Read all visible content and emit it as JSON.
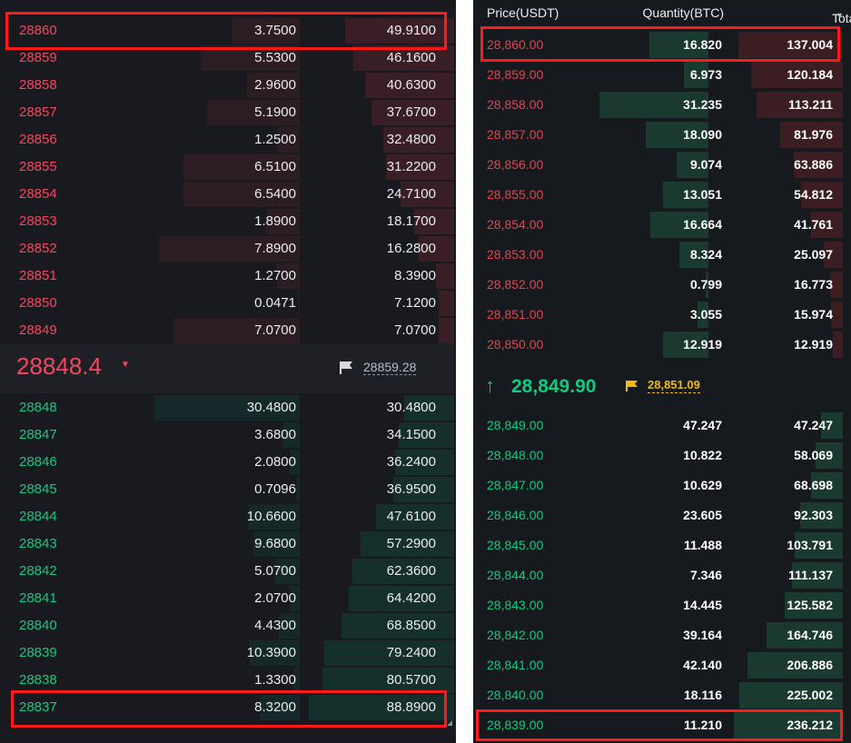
{
  "left_panel": {
    "asks": [
      {
        "price": "28860",
        "quantity": "3.7500",
        "total": "49.9100"
      },
      {
        "price": "28859",
        "quantity": "5.5300",
        "total": "46.1600"
      },
      {
        "price": "28858",
        "quantity": "2.9600",
        "total": "40.6300"
      },
      {
        "price": "28857",
        "quantity": "5.1900",
        "total": "37.6700"
      },
      {
        "price": "28856",
        "quantity": "1.2500",
        "total": "32.4800"
      },
      {
        "price": "28855",
        "quantity": "6.5100",
        "total": "31.2200"
      },
      {
        "price": "28854",
        "quantity": "6.5400",
        "total": "24.7100"
      },
      {
        "price": "28853",
        "quantity": "1.8900",
        "total": "18.1700"
      },
      {
        "price": "28852",
        "quantity": "7.8900",
        "total": "16.2800"
      },
      {
        "price": "28851",
        "quantity": "1.2700",
        "total": "8.3900"
      },
      {
        "price": "28850",
        "quantity": "0.0471",
        "total": "7.1200"
      },
      {
        "price": "28849",
        "quantity": "7.0700",
        "total": "7.0700"
      }
    ],
    "last_price": "28848.4",
    "mark_price": "28859.28",
    "bids": [
      {
        "price": "28848",
        "quantity": "30.4800",
        "total": "30.4800"
      },
      {
        "price": "28847",
        "quantity": "3.6800",
        "total": "34.1500"
      },
      {
        "price": "28846",
        "quantity": "2.0800",
        "total": "36.2400"
      },
      {
        "price": "28845",
        "quantity": "0.7096",
        "total": "36.9500"
      },
      {
        "price": "28844",
        "quantity": "10.6600",
        "total": "47.6100"
      },
      {
        "price": "28843",
        "quantity": "9.6800",
        "total": "57.2900"
      },
      {
        "price": "28842",
        "quantity": "5.0700",
        "total": "62.3600"
      },
      {
        "price": "28841",
        "quantity": "2.0700",
        "total": "64.4200"
      },
      {
        "price": "28840",
        "quantity": "4.4300",
        "total": "68.8500"
      },
      {
        "price": "28839",
        "quantity": "10.3900",
        "total": "79.2400"
      },
      {
        "price": "28838",
        "quantity": "1.3300",
        "total": "80.5700"
      },
      {
        "price": "28837",
        "quantity": "8.3200",
        "total": "88.8900"
      }
    ]
  },
  "right_panel": {
    "header": {
      "price": "Price(USDT)",
      "quantity": "Quantity(BTC)",
      "total": "Total(BTC)"
    },
    "asks": [
      {
        "price": "28,860.00",
        "quantity": "16.820",
        "total": "137.004"
      },
      {
        "price": "28,859.00",
        "quantity": "6.973",
        "total": "120.184"
      },
      {
        "price": "28,858.00",
        "quantity": "31.235",
        "total": "113.211"
      },
      {
        "price": "28,857.00",
        "quantity": "18.090",
        "total": "81.976"
      },
      {
        "price": "28,856.00",
        "quantity": "9.074",
        "total": "63.886"
      },
      {
        "price": "28,855.00",
        "quantity": "13.051",
        "total": "54.812"
      },
      {
        "price": "28,854.00",
        "quantity": "16.664",
        "total": "41.761"
      },
      {
        "price": "28,853.00",
        "quantity": "8.324",
        "total": "25.097"
      },
      {
        "price": "28,852.00",
        "quantity": "0.799",
        "total": "16.773"
      },
      {
        "price": "28,851.00",
        "quantity": "3.055",
        "total": "15.974"
      },
      {
        "price": "28,850.00",
        "quantity": "12.919",
        "total": "12.919"
      }
    ],
    "last_price": "28,849.90",
    "mark_price": "28,851.09",
    "bids": [
      {
        "price": "28,849.00",
        "quantity": "47.247",
        "total": "47.247"
      },
      {
        "price": "28,848.00",
        "quantity": "10.822",
        "total": "58.069"
      },
      {
        "price": "28,847.00",
        "quantity": "10.629",
        "total": "68.698"
      },
      {
        "price": "28,846.00",
        "quantity": "23.605",
        "total": "92.303"
      },
      {
        "price": "28,845.00",
        "quantity": "11.488",
        "total": "103.791"
      },
      {
        "price": "28,844.00",
        "quantity": "7.346",
        "total": "111.137"
      },
      {
        "price": "28,843.00",
        "quantity": "14.445",
        "total": "125.582"
      },
      {
        "price": "28,842.00",
        "quantity": "39.164",
        "total": "164.746"
      },
      {
        "price": "28,841.00",
        "quantity": "42.140",
        "total": "206.886"
      },
      {
        "price": "28,840.00",
        "quantity": "18.116",
        "total": "225.002"
      },
      {
        "price": "28,839.00",
        "quantity": "11.210",
        "total": "236.212"
      }
    ]
  },
  "colors": {
    "ask": "#f6465d",
    "bid": "#0ecb81",
    "highlight": "#ff1a1a",
    "mark_price": "#f0b90b"
  },
  "icons": {
    "price_direction_left": "caret-down-icon",
    "price_direction_right": "arrow-up-icon",
    "mark_price": "flag-icon",
    "sort": "caret-down-icon"
  }
}
